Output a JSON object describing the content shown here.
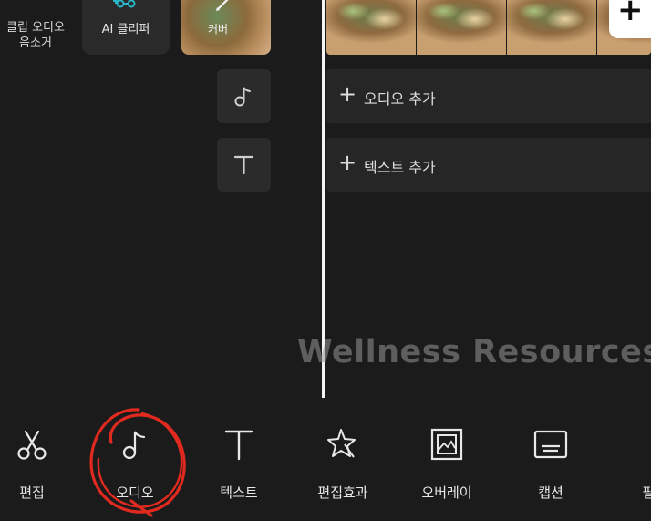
{
  "top_tools": {
    "remove_audio_label": "클립 오디오\n음소거",
    "ai_clipper_label": "AI 클리퍼",
    "cover_label": "커버"
  },
  "timeline": {
    "add_audio_label": "오디오 추가",
    "add_text_label": "텍스트 추가",
    "add_plus": "+"
  },
  "watermark": "Wellness Resources",
  "toolbar": {
    "items": [
      {
        "label": "편집",
        "icon": "scissors-icon"
      },
      {
        "label": "오디오",
        "icon": "music-note-icon"
      },
      {
        "label": "텍스트",
        "icon": "text-icon"
      },
      {
        "label": "편집효과",
        "icon": "sparkle-star-icon"
      },
      {
        "label": "오버레이",
        "icon": "overlay-image-icon"
      },
      {
        "label": "캡션",
        "icon": "caption-icon"
      },
      {
        "label": "필",
        "icon": "filter-icon"
      }
    ]
  },
  "colors": {
    "background": "#1b1b1b",
    "tile": "#2b2b2b",
    "ai_accent": "#29b6c8",
    "annotation_circle": "#e02a20"
  }
}
